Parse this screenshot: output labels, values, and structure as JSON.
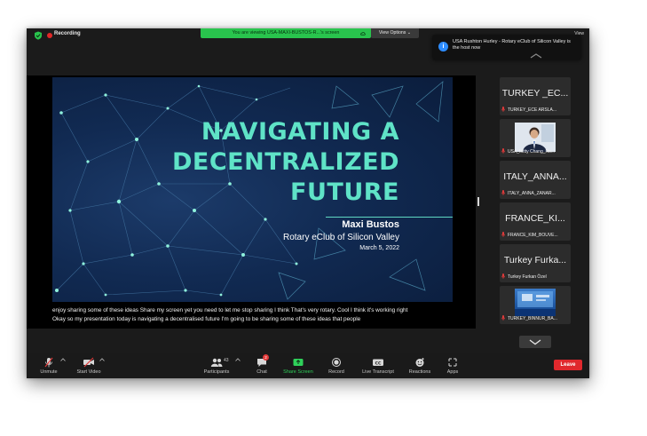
{
  "topbar": {
    "recording_label": "Recording",
    "banner_text": "You are viewing USA-MAXI-BUSTOS-R...'s screen",
    "view_options_label": "View Options ⌄",
    "view_label": "View"
  },
  "notification": {
    "icon": "i",
    "text": "USA Rushton Hurley - Rotary eClub of Silicon Valley is the host now"
  },
  "slide": {
    "title_line1": "NAVIGATING A",
    "title_line2": "DECENTRALIZED",
    "title_line3": "FUTURE",
    "author": "Maxi Bustos",
    "club": "Rotary eClub of Silicon Valley",
    "date": "March 5, 2022"
  },
  "captions": {
    "line1": "enjoy sharing some of these ideas Share my screen yet you need to let me stop sharing I think That's very rotary. Cool I think it's working right",
    "line2": "Okay so my presentation today is navigating a decentralised future I'm going to be sharing some of these ideas that people"
  },
  "gallery": [
    {
      "big_name": "TURKEY _EC...",
      "label": "TURKEY_ECE ARSLA..."
    },
    {
      "big_name": "",
      "label": "USA_Mitty Chang_Ro..."
    },
    {
      "big_name": "ITALY_ANNA...",
      "label": "ITALY_ANNA_ZANAR..."
    },
    {
      "big_name": "FRANCE_KI...",
      "label": "FRANCE_KIM_BOUVE..."
    },
    {
      "big_name": "Turkey Furka...",
      "label": "Turkey Furkan Özel"
    },
    {
      "big_name": "",
      "label": "TURKEY_BINNUR_BA..."
    }
  ],
  "toolbar": {
    "unmute": "Unmute",
    "start_video": "Start Video",
    "participants": "Participants",
    "participants_count": "43",
    "chat": "Chat",
    "chat_badge": "2",
    "share_screen": "Share Screen",
    "record": "Record",
    "live_transcript": "Live Transcript",
    "reactions": "Reactions",
    "apps": "Apps",
    "leave": "Leave"
  },
  "colors": {
    "accent_green": "#29c44d",
    "slide_title": "#5fe3c7",
    "leave_red": "#e0282d",
    "host_blue": "#2d8cff"
  }
}
